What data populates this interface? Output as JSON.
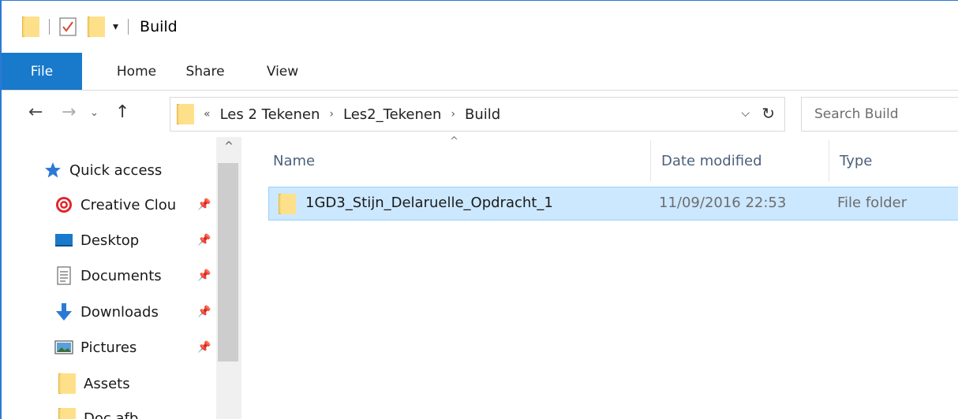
{
  "window": {
    "title": "Build",
    "qa_dropdown": "▾"
  },
  "ribbon": {
    "tabs": [
      {
        "label": "File"
      },
      {
        "label": "Home"
      },
      {
        "label": "Share"
      },
      {
        "label": "View"
      }
    ]
  },
  "address": {
    "overflow": "«",
    "breadcrumbs": [
      "Les 2 Tekenen",
      "Les2_Tekenen",
      "Build"
    ],
    "separator": "›",
    "search_placeholder": "Search Build"
  },
  "nav": {
    "quick_access": "Quick access",
    "items": [
      {
        "label": "Creative Clou",
        "icon": "creative-cloud-icon",
        "pinned": true
      },
      {
        "label": "Desktop",
        "icon": "desktop-icon",
        "pinned": true
      },
      {
        "label": "Documents",
        "icon": "documents-icon",
        "pinned": true
      },
      {
        "label": "Downloads",
        "icon": "downloads-icon",
        "pinned": true
      },
      {
        "label": "Pictures",
        "icon": "pictures-icon",
        "pinned": true
      },
      {
        "label": "Assets",
        "icon": "folder-icon",
        "pinned": false
      },
      {
        "label": "Doc afb",
        "icon": "folder-icon",
        "pinned": false
      }
    ]
  },
  "files": {
    "columns": [
      "Name",
      "Date modified",
      "Type"
    ],
    "rows": [
      {
        "name": "1GD3_Stijn_Delaruelle_Opdracht_1",
        "date": "11/09/2016 22:53",
        "type": "File folder",
        "selected": true
      }
    ]
  },
  "colors": {
    "accent": "#1979ca",
    "selection": "#cce8ff",
    "selection_border": "#99d1ff",
    "folder": "#ffe08a"
  }
}
